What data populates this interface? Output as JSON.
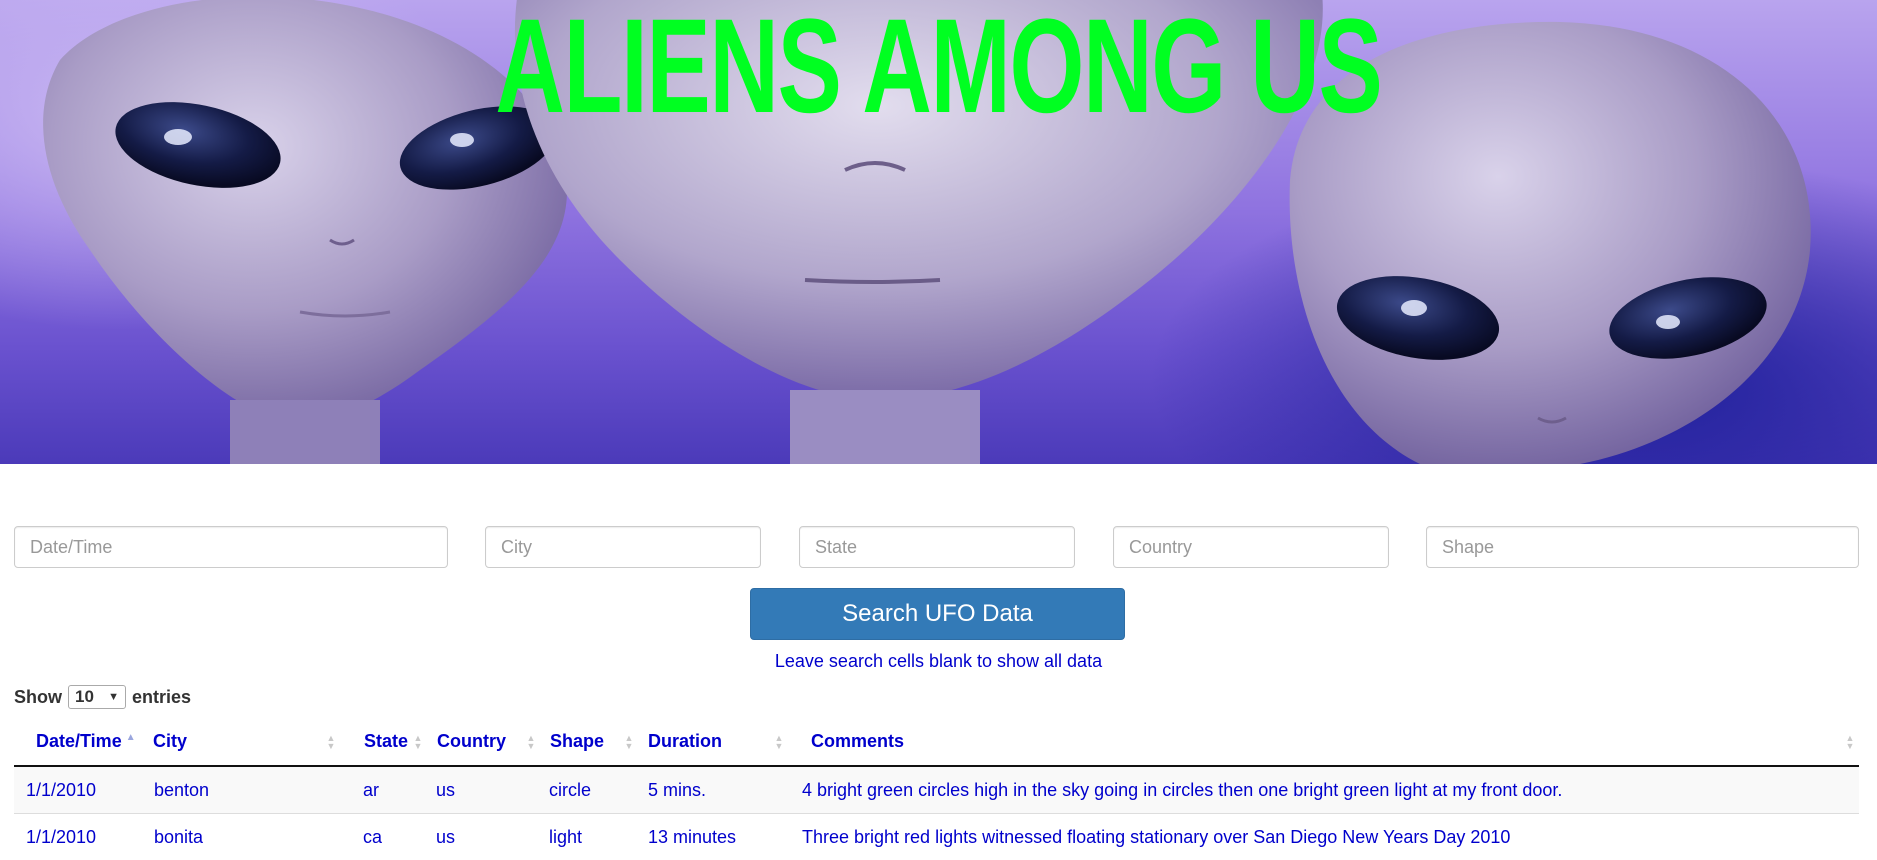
{
  "hero": {
    "title": "ALIENS AMONG US"
  },
  "search": {
    "fields": [
      {
        "name": "datetime",
        "placeholder": "Date/Time"
      },
      {
        "name": "city",
        "placeholder": "City"
      },
      {
        "name": "state",
        "placeholder": "State"
      },
      {
        "name": "country",
        "placeholder": "Country"
      },
      {
        "name": "shape",
        "placeholder": "Shape"
      }
    ],
    "button_label": "Search UFO Data",
    "hint": "Leave search cells blank to show all data"
  },
  "length": {
    "show_label": "Show",
    "selected": "10",
    "entries_label": "entries"
  },
  "table": {
    "columns": [
      "Date/Time",
      "City",
      "State",
      "Country",
      "Shape",
      "Duration",
      "Comments"
    ],
    "sorted_column": "Date/Time",
    "sort_direction": "ascending",
    "rows": [
      [
        "1/1/2010",
        "benton",
        "ar",
        "us",
        "circle",
        "5 mins.",
        "4 bright green circles high in the sky going in circles then one bright green light at my front door."
      ],
      [
        "1/1/2010",
        "bonita",
        "ca",
        "us",
        "light",
        "13 minutes",
        "Three bright red lights witnessed floating stationary over San Diego New Years Day 2010"
      ]
    ]
  },
  "colors": {
    "title": "#00ff21",
    "button": "#337ab7",
    "link_text": "#0000cc"
  }
}
